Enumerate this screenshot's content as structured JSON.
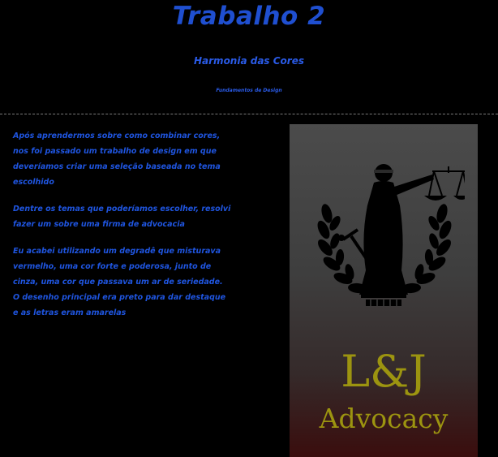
{
  "header": {
    "title": "Trabalho 2",
    "subtitle": "Harmonia das Cores",
    "caption": "Fundamentos de Design"
  },
  "content": {
    "paragraphs": [
      "Após aprendermos sobre como combinar cores, nos foi passado um trabalho de design em que deveríamos criar uma seleção baseada no tema escolhido",
      "Dentre os temas que poderíamos escolher, resolvi fazer um sobre uma firma de advocacia",
      "Eu acabei utilizando um degradê que misturava vermelho, uma cor forte e poderosa, junto de cinza, uma cor que passava um ar de seriedade. O desenho principal era preto para dar destaque e as letras eram amarelas"
    ]
  },
  "poster": {
    "emblem_icon": "lady-justice-icon",
    "brand_name": "L&J",
    "brand_sub": "Advocacy",
    "colors": {
      "gradient_top": "#4b4b4b",
      "gradient_bottom": "#3a0d0d",
      "text": "#9c9410",
      "emblem": "#000000"
    }
  },
  "colors": {
    "background": "#000000",
    "text_blue": "#1f55e0",
    "divider": "#7a7a7a"
  }
}
